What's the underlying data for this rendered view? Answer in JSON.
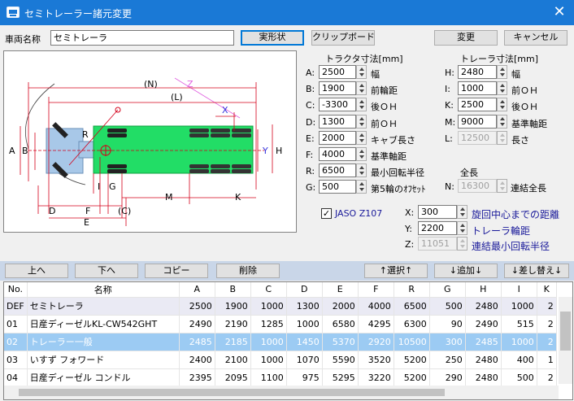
{
  "window": {
    "title": "セミトレーラー諸元変更",
    "close_glyph": "✕"
  },
  "top": {
    "vehicle_name_label": "車両名称",
    "vehicle_name_value": "セミトレーラ",
    "shape_button": "実形状",
    "clipboard_button": "クリップボード",
    "change_button": "変更",
    "cancel_button": "キャンセル"
  },
  "tractor": {
    "header": "トラクタ寸法[mm]",
    "fields": [
      {
        "key": "A",
        "value": "2500",
        "desc": "幅"
      },
      {
        "key": "B",
        "value": "1900",
        "desc": "前輪距"
      },
      {
        "key": "C",
        "value": "-3300",
        "desc": "後ＯＨ"
      },
      {
        "key": "D",
        "value": "1300",
        "desc": "前ＯＨ"
      },
      {
        "key": "E",
        "value": "2000",
        "desc": "キャブ長さ"
      },
      {
        "key": "F",
        "value": "4000",
        "desc": "基準軸距"
      },
      {
        "key": "R",
        "value": "6500",
        "desc": "最小回転半径"
      },
      {
        "key": "G",
        "value": "500",
        "desc": "第5輪のｵﾌｾｯﾄ"
      }
    ]
  },
  "trailer": {
    "header": "トレーラ寸法[mm]",
    "fields": [
      {
        "key": "H",
        "value": "2480",
        "desc": "幅"
      },
      {
        "key": "I",
        "value": "1000",
        "desc": "前ＯＨ"
      },
      {
        "key": "K",
        "value": "2500",
        "desc": "後ＯＨ"
      },
      {
        "key": "M",
        "value": "9000",
        "desc": "基準軸距"
      },
      {
        "key": "L",
        "value": "12500",
        "desc": "長さ"
      }
    ]
  },
  "total": {
    "header": "全長",
    "key": "N",
    "value": "16300",
    "desc": "連結全長"
  },
  "jaso": {
    "checked": "✓",
    "label": "JASO Z107",
    "fields": [
      {
        "key": "X",
        "value": "300",
        "desc": "旋回中心までの距離"
      },
      {
        "key": "Y",
        "value": "2200",
        "desc": "トレーラ輪距"
      },
      {
        "key": "Z",
        "value": "11051",
        "desc": "連結最小回転半径"
      }
    ]
  },
  "diagram": {
    "labels": {
      "N": "(N)",
      "L": "(L)",
      "Z": "Z",
      "X": "X",
      "Y": "Y",
      "H": "H",
      "A": "A",
      "B": "B",
      "R": "R",
      "I": "I",
      "G": "G",
      "M": "M",
      "K": "K",
      "D": "D",
      "F": "F",
      "C": "(C)",
      "E": "E"
    }
  },
  "toolbar": {
    "up": "上へ",
    "down": "下へ",
    "copy": "コピー",
    "delete": "削除",
    "select": "↑選択↑",
    "add": "↓追加↓",
    "replace": "↓差し替え↓"
  },
  "table": {
    "columns": [
      "No.",
      "名称",
      "A",
      "B",
      "C",
      "D",
      "E",
      "F",
      "R",
      "G",
      "H",
      "I",
      "K"
    ],
    "rows": [
      [
        "DEF",
        "セミトレーラ",
        "2500",
        "1900",
        "1000",
        "1300",
        "2000",
        "4000",
        "6500",
        "500",
        "2480",
        "1000",
        "2"
      ],
      [
        "01",
        "日産ディーゼルKL-CW542GHT",
        "2490",
        "2190",
        "1285",
        "1000",
        "6580",
        "4295",
        "6300",
        "90",
        "2490",
        "515",
        "2"
      ],
      [
        "02",
        "トレーラー一般",
        "2485",
        "2185",
        "1000",
        "1450",
        "5370",
        "2920",
        "10500",
        "300",
        "2485",
        "1000",
        "2"
      ],
      [
        "03",
        "いすず フォワード",
        "2400",
        "2100",
        "1000",
        "1070",
        "5590",
        "3520",
        "5200",
        "250",
        "2480",
        "400",
        "1"
      ],
      [
        "04",
        "日産ディーゼル コンドル",
        "2395",
        "2095",
        "1100",
        "975",
        "5295",
        "3220",
        "5200",
        "290",
        "2480",
        "500",
        "2"
      ]
    ]
  },
  "colors": {
    "titlebar": "#1a79d6",
    "trailer_body": "#22dd66",
    "tractor_body": "#a8c8e8",
    "dimension_lines": "#d4001a",
    "selected_row": "#9ccbf3"
  }
}
